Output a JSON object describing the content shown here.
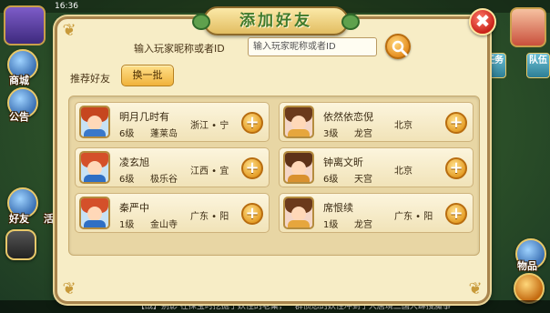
{
  "status_bar": {
    "time": "16:36"
  },
  "hud": {
    "left_labels": [
      "商城",
      "公告",
      "好友",
      "活"
    ],
    "right_tabs": [
      "任务",
      "队伍"
    ],
    "right_labels": [
      "物品"
    ],
    "ticker": "【战】别影   在探宝时挖掘了妖怪的老巢，一群愤怒的妖怪冲到了大唐境三国大肆搜魔事"
  },
  "dialog": {
    "title": "添加好友",
    "close_glyph": "✖",
    "search": {
      "label": "输入玩家昵称或者ID",
      "placeholder": "输入玩家昵称或者ID"
    },
    "recommend_label": "推荐好友",
    "refresh_label": "换一批",
    "add_glyph": "+",
    "friends": [
      {
        "name": "明月几时有",
        "level": "6级",
        "sect": "蓬莱岛",
        "location": "浙江 • 宁",
        "avatar": "boy-red"
      },
      {
        "name": "依然依恋倪",
        "level": "3级",
        "sect": "龙宫",
        "location": "北京",
        "avatar": "girl-brown"
      },
      {
        "name": "凌玄旭",
        "level": "6级",
        "sect": "极乐谷",
        "location": "江西 • 宜",
        "avatar": "girl-red"
      },
      {
        "name": "钟离文昕",
        "level": "6级",
        "sect": "天宫",
        "location": "北京",
        "avatar": "boy-brown"
      },
      {
        "name": "秦严中",
        "level": "1级",
        "sect": "金山寺",
        "location": "广东 • 阳",
        "avatar": "girl-red"
      },
      {
        "name": "席恨续",
        "level": "1级",
        "sect": "龙宫",
        "location": "广东 • 阳",
        "avatar": "girl-brown"
      }
    ]
  },
  "colors": {
    "dialog_bg": "#f7edc6",
    "title_green": "#3f7a2c",
    "button_orange": "#f0b23c",
    "close_red": "#c9221a"
  }
}
